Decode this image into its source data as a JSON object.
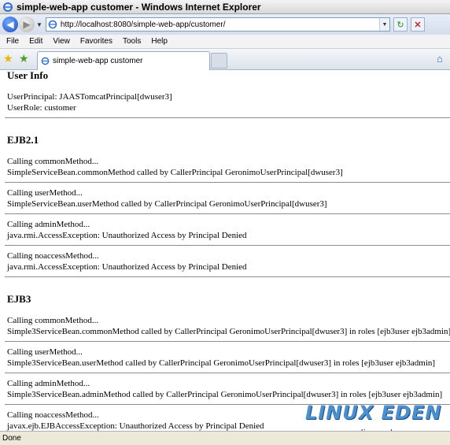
{
  "window": {
    "title": "simple-web-app customer - Windows Internet Explorer"
  },
  "address": {
    "url": "http://localhost:8080/simple-web-app/customer/"
  },
  "menu": [
    "File",
    "Edit",
    "View",
    "Favorites",
    "Tools",
    "Help"
  ],
  "tab": {
    "label": "simple-web-app customer"
  },
  "page": {
    "user_info": {
      "heading": "User Info",
      "principal": "UserPrincipal: JAASTomcatPrincipal[dwuser3]",
      "role": "UserRole: customer"
    },
    "ejb21": {
      "heading": "EJB2.1",
      "calls": [
        {
          "call": "Calling commonMethod...",
          "result": "SimpleServiceBean.commonMethod called by CallerPrincipal GeronimoUserPrincipal[dwuser3]"
        },
        {
          "call": "Calling userMethod...",
          "result": "SimpleServiceBean.userMethod called by CallerPrincipal GeronimoUserPrincipal[dwuser3]"
        },
        {
          "call": "Calling adminMethod...",
          "result": "java.rmi.AccessException: Unauthorized Access by Principal Denied"
        },
        {
          "call": "Calling noaccessMethod...",
          "result": "java.rmi.AccessException: Unauthorized Access by Principal Denied"
        }
      ]
    },
    "ejb3": {
      "heading": "EJB3",
      "calls": [
        {
          "call": "Calling commonMethod...",
          "result": "Simple3ServiceBean.commonMethod called by CallerPrincipal GeronimoUserPrincipal[dwuser3] in roles [ejb3user ejb3admin]"
        },
        {
          "call": "Calling userMethod...",
          "result": "Simple3ServiceBean.userMethod called by CallerPrincipal GeronimoUserPrincipal[dwuser3] in roles [ejb3user ejb3admin]"
        },
        {
          "call": "Calling adminMethod...",
          "result": "Simple3ServiceBean.adminMethod called by CallerPrincipal GeronimoUserPrincipal[dwuser3] in roles [ejb3user ejb3admin]"
        },
        {
          "call": "Calling noaccessMethod...",
          "result": "javax.ejb.EJBAccessException: Unauthorized Access by Principal Denied"
        }
      ]
    }
  },
  "status": {
    "text": "Done"
  },
  "watermark": {
    "logo": "LINUX EDEN",
    "url": "www.linuxeden.com"
  }
}
